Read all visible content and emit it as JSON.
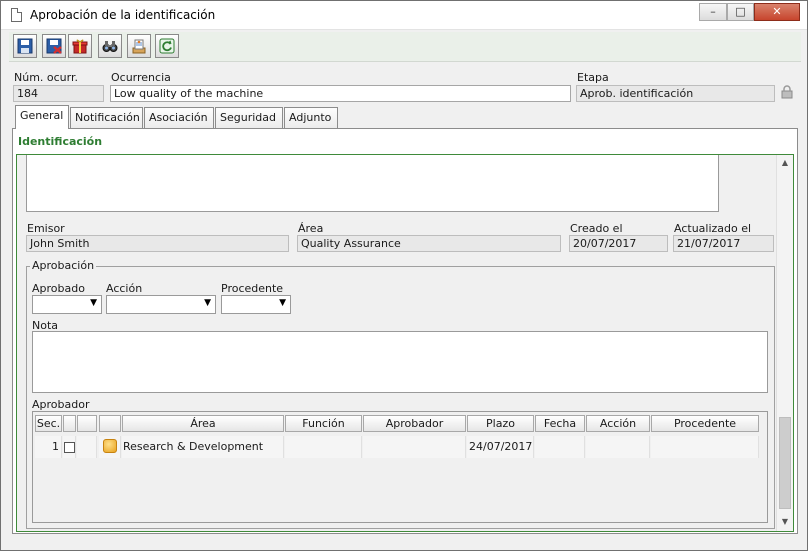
{
  "window": {
    "title": "Aprobación de la identificación",
    "controls": {
      "minimize": "–",
      "maximize": "□",
      "close": "✕"
    }
  },
  "toolbar": {
    "buttons": [
      "save-icon",
      "save-close-icon",
      "gift-icon",
      "binoculars-icon",
      "send-icon",
      "refresh-icon"
    ]
  },
  "header": {
    "num_label": "Núm. ocurr.",
    "num_value": "184",
    "ocurrencia_label": "Ocurrencia",
    "ocurrencia_value": "Low quality of the machine",
    "etapa_label": "Etapa",
    "etapa_value": "Aprob. identificación"
  },
  "tabs": [
    "General",
    "Notificación",
    "Asociación",
    "Seguridad",
    "Adjunto"
  ],
  "section": {
    "title": "Identificación"
  },
  "info": {
    "emisor_label": "Emisor",
    "emisor_value": "John Smith",
    "area_label": "Área",
    "area_value": "Quality Assurance",
    "creado_label": "Creado el",
    "creado_value": "20/07/2017",
    "actualizado_label": "Actualizado el",
    "actualizado_value": "21/07/2017"
  },
  "aprobacion": {
    "legend": "Aprobación",
    "aprobado_label": "Aprobado",
    "accion_label": "Acción",
    "procedente_label": "Procedente",
    "nota_label": "Nota",
    "aprobador_label": "Aprobador",
    "grid": {
      "headers": [
        "Sec.",
        "",
        "",
        "",
        "Área",
        "Función",
        "Aprobador",
        "Plazo",
        "Fecha",
        "Acción",
        "Procedente"
      ],
      "rows": [
        {
          "sec": "1",
          "area": "Research & Development",
          "funcion": "",
          "aprobador": "",
          "plazo": "24/07/2017",
          "fecha": "",
          "accion": "",
          "procedente": ""
        }
      ]
    }
  }
}
